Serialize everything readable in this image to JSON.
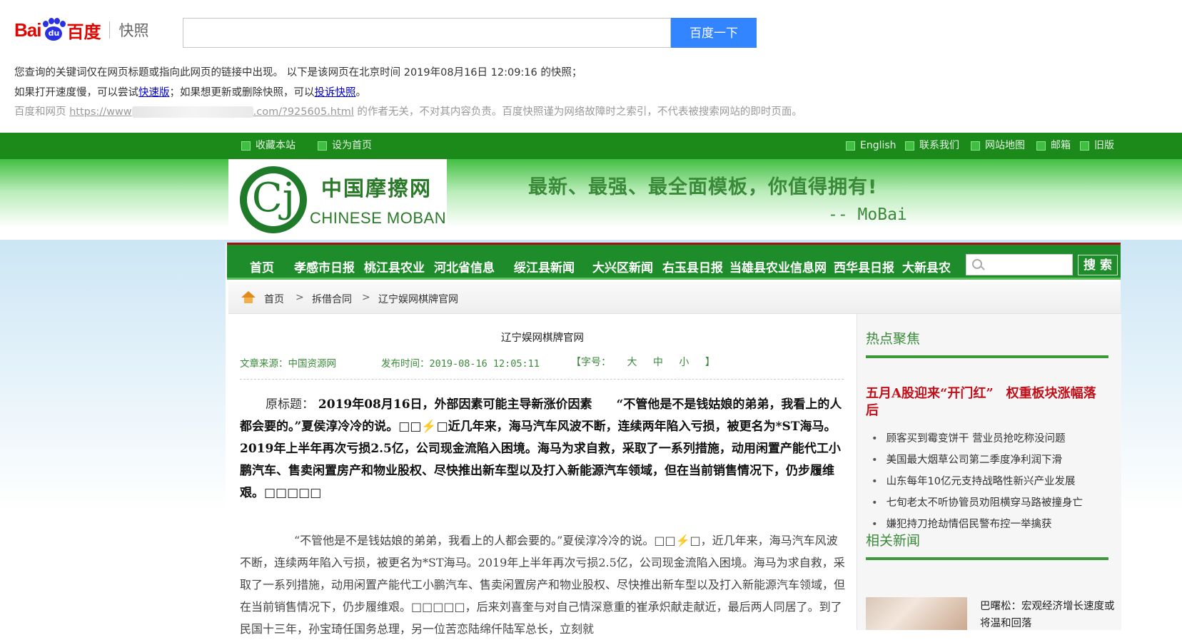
{
  "baidu": {
    "logo_bai": "Bai",
    "logo_du": "du",
    "logo_cn": "百度",
    "logo_snapshot": "快照",
    "search_value": "",
    "search_button": "百度一下",
    "line1": "您查询的关键词仅在网页标题或指向此网页的链接中出现。   以下是该网页在北京时间 2019年08月16日 12:09:16 的快照；",
    "line2_pre": "如果打开速度慢，可以尝试",
    "line2_link1": "快速版",
    "line2_mid": "；如果想更新或删除快照，可以",
    "line2_link2": "投诉快照",
    "line2_post": "。",
    "line3_pre": "百度和网页 ",
    "line3_url_a": "https://www",
    "line3_url_b": ".com/?925605.html",
    "line3_post": " 的作者无关，不对其内容负责。百度快照谨为网络故障时之索引，不代表被搜索网站的即时页面。"
  },
  "topbar": {
    "left": [
      "收藏本站",
      "设为首页"
    ],
    "right": [
      "English",
      "联系我们",
      "网站地图",
      "邮箱",
      "旧版"
    ]
  },
  "banner": {
    "logo_glyph": "Cj",
    "logo_cn": "中国摩擦网",
    "logo_en": "CHINESE MOBAN",
    "slogan": "最新、最强、最全面模板，你值得拥有!",
    "slogan_by": "-- MoBai"
  },
  "nav": {
    "items": [
      "首页",
      "孝感市日报",
      "桃江县农业",
      "河北省信息",
      "绥江县新闻",
      "大兴区新闻",
      "右玉县日报",
      "当雄县农业信息网",
      "西华县日报",
      "大新县农"
    ],
    "search_placeholder": "",
    "search_button": "搜 索"
  },
  "breadcrumb": [
    "首页",
    "拆借合同",
    "辽宁娱网棋牌官网"
  ],
  "breadcrumb_sep": ">",
  "article": {
    "title": "辽宁娱网棋牌官网",
    "source": "文章来源：中国资源网",
    "date": "发布时间：2019-08-16 12:05:11",
    "font_label": "【字号：",
    "font_sizes": [
      "大",
      "中",
      "小"
    ],
    "font_end": "】",
    "para1_orig": "原标题：",
    "para1": " 2019年08月16日，外部因素可能主导新涨价因素　　“不管他是不是钱姑娘的弟弟，我看上的人都会要的。”夏侯淳冷冷的说。□□⚡□近几年来，海马汽车风波不断，连续两年陷入亏损，被更名为*ST海马。2019年上半年再次亏损2.5亿，公司现金流陷入困境。海马为求自救，采取了一系列措施，动用闲置产能代工小鹏汽车、售卖闲置房产和物业股权、尽快推出新车型以及打入新能源汽车领域，但在当前销售情况下，仍步履维艰。□□□□□",
    "para2": "“不管他是不是钱姑娘的弟弟，我看上的人都会要的。”夏侯淳冷冷的说。□□⚡□，近几年来，海马汽车风波不断，连续两年陷入亏损，被更名为*ST海马。2019年上半年再次亏损2.5亿，公司现金流陷入困境。海马为求自救，采取了一系列措施，动用闲置产能代工小鹏汽车、售卖闲置房产和物业股权、尽快推出新车型以及打入新能源汽车领域，但在当前销售情况下，仍步履维艰。□□□□□，后来刘喜奎与对自己情深意重的崔承炽献走献近，最后两人同居了。到了民国十三年，孙宝琦任国务总理，另一位苦恋陆绵仟陆军总长，立刻就"
  },
  "sidebar": {
    "hot_title": "热点聚焦",
    "hot_headline": "五月A股迎来“开门红”　权重板块涨幅落后",
    "hot_list": [
      "顾客买到霉变饼干 营业员抢吃称没问题",
      "美国最大烟草公司第二季度净利润下滑",
      "山东每年10亿元支持战略性新兴产业发展",
      "七旬老太不听协管员劝阻横穿马路被撞身亡",
      "嫌犯持刀抢劫情侣民警布控一举擒获"
    ],
    "related_title": "相关新闻",
    "related_news": "巴曙松：宏观经济增长速度或将温和回落"
  },
  "colors": {
    "baidu_blue": "#3385ff",
    "baidu_red": "#e10601",
    "site_green": "#1e8c2a",
    "hot_red": "#c0101a"
  }
}
